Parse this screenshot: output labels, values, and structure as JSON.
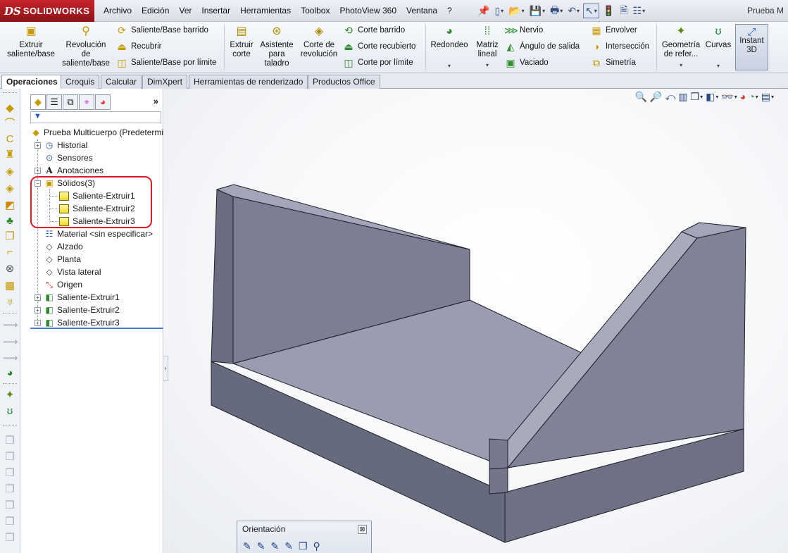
{
  "app": {
    "logo_ds": "DS",
    "logo_name": "SOLIDWORKS",
    "doc_title": "Prueba M"
  },
  "menu": [
    "Archivo",
    "Edición",
    "Ver",
    "Insertar",
    "Herramientas",
    "Toolbox",
    "PhotoView 360",
    "Ventana",
    "?"
  ],
  "quick_tools": [
    {
      "icon": "pin-icon",
      "glyph": "📌"
    },
    {
      "icon": "new-document-icon",
      "glyph": "▯"
    },
    {
      "icon": "open-icon",
      "glyph": "📂"
    },
    {
      "icon": "save-icon",
      "glyph": "💾"
    },
    {
      "icon": "print-icon",
      "glyph": "🖶"
    },
    {
      "icon": "undo-icon",
      "glyph": "↶"
    },
    {
      "icon": "select-arrow-icon",
      "glyph": "↖"
    },
    {
      "icon": "rebuild-traffic-light-icon",
      "glyph": "🚦"
    },
    {
      "icon": "file-properties-icon",
      "glyph": "🗎"
    },
    {
      "icon": "options-icon",
      "glyph": "☷"
    }
  ],
  "ribbon": {
    "extruir": "Extruir saliente/base",
    "revolucion": "Revolución de saliente/base",
    "barrido": "Saliente/Base barrido",
    "recubrir": "Recubrir",
    "por_limite": "Saliente/Base por límite",
    "extruir_corte": "Extruir corte",
    "asistente": "Asistente para taladro",
    "corte_revolucion": "Corte de revolución",
    "corte_barrido": "Corte barrido",
    "corte_recubierto": "Corte recubierto",
    "corte_limite": "Corte por límite",
    "redondeo": "Redondeo",
    "matriz": "Matriz lineal",
    "nervio": "Nervio",
    "angulo": "Ángulo de salida",
    "vaciado": "Vaciado",
    "envolver": "Envolver",
    "interseccion": "Intersección",
    "simetria": "Simetría",
    "geometria": "Geometría de refer...",
    "curvas": "Curvas",
    "instant3d": "Instant 3D"
  },
  "tabs": [
    "Operaciones",
    "Croquis",
    "Calcular",
    "DimXpert",
    "Herramientas de renderizado",
    "Productos Office"
  ],
  "active_tab": "Operaciones",
  "tree": {
    "root": "Prueba Multicuerpo  (Predeterminado)",
    "historial": "Historial",
    "sensores": "Sensores",
    "anotaciones": "Anotaciones",
    "solidos": "Sólidos(3)",
    "bodies": [
      "Saliente-Extruir1",
      "Saliente-Extruir2",
      "Saliente-Extruir3"
    ],
    "material": "Material <sin especificar>",
    "alzado": "Alzado",
    "planta": "Planta",
    "vista_lateral": "Vista lateral",
    "origen": "Origen",
    "features": [
      "Saliente-Extruir1",
      "Saliente-Extruir2",
      "Saliente-Extruir3"
    ]
  },
  "orientation": {
    "title": "Orientación",
    "close": "⊠"
  },
  "colors": {
    "accent_red": "#e21b24",
    "model_top": "#9a9cb0",
    "model_front": "#666a7d",
    "model_left": "#7a7e92",
    "model_edge": "#1e1f28",
    "body_icon": "#f4dc30"
  }
}
